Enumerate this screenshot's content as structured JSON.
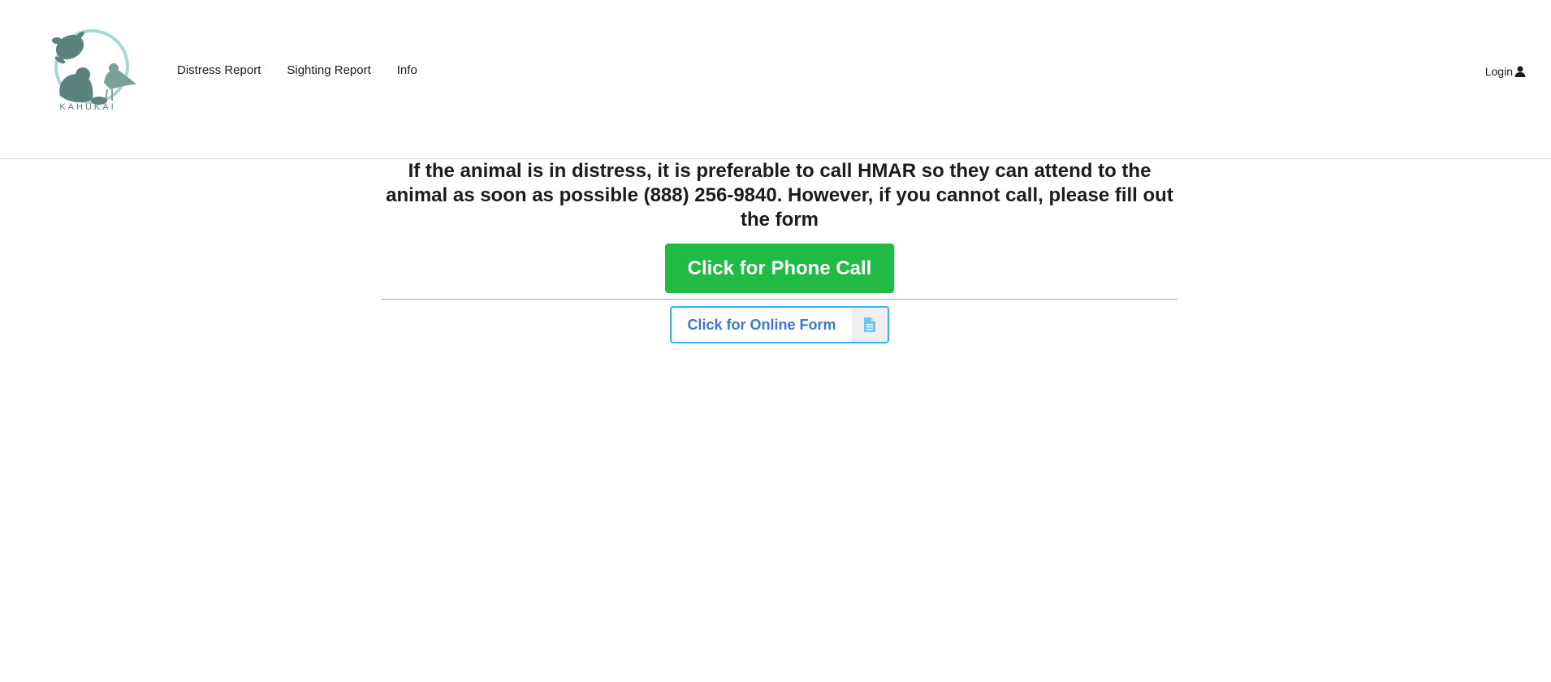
{
  "header": {
    "logo": {
      "text": "KAHUKAI",
      "icon": "kahukai-logo-icon"
    },
    "nav": [
      {
        "label": "Distress Report"
      },
      {
        "label": "Sighting Report"
      },
      {
        "label": "Info"
      }
    ],
    "login": {
      "label": "Login",
      "icon": "user-icon"
    }
  },
  "main": {
    "message": "If the animal is in distress, it is preferable to call HMAR so they can attend to the animal as soon as possible (888) 256-9840. However, if you cannot call, please fill out the form",
    "phone_button": {
      "label": "Click for Phone Call"
    },
    "form_button": {
      "label": "Click for Online Form",
      "icon": "document-icon"
    }
  },
  "colors": {
    "phone_button": "#21ba45",
    "form_button_border": "#2fb7ef",
    "form_button_text": "#3d7bbf",
    "logo_primary": "#5b827c",
    "logo_circle": "#a9d8d4"
  }
}
